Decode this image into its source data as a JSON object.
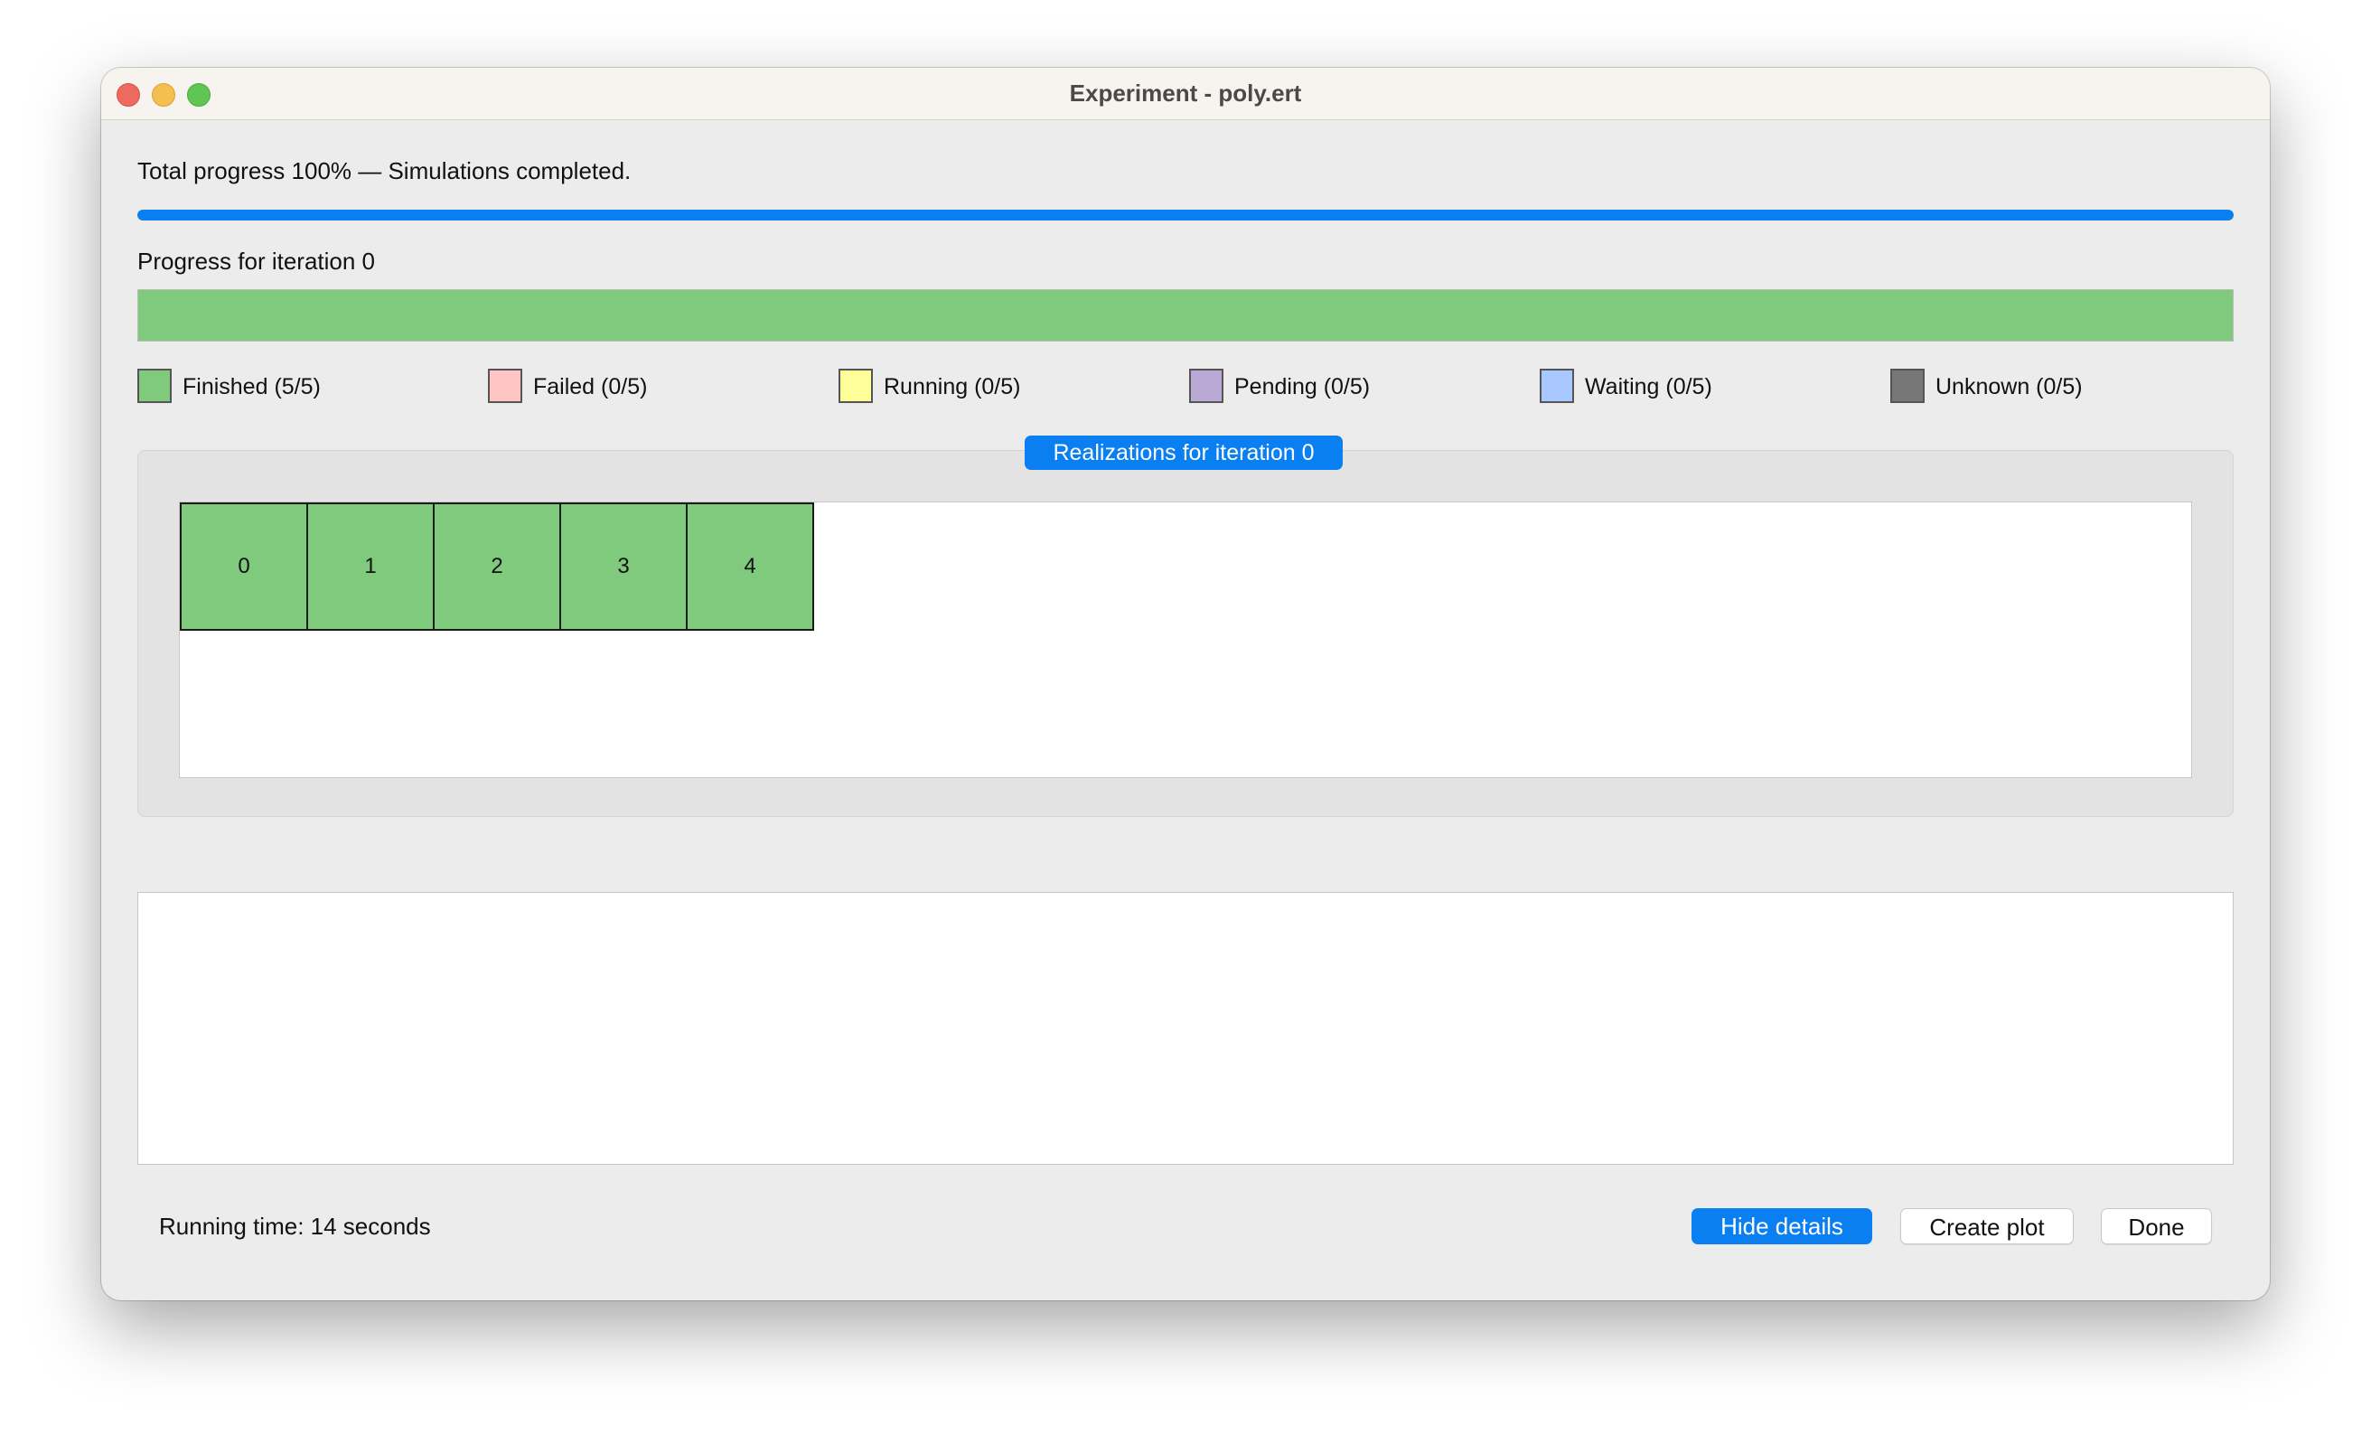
{
  "window": {
    "title": "Experiment - poly.ert"
  },
  "total_progress": {
    "label": "Total progress 100% — Simulations completed.",
    "value": 100
  },
  "iteration_progress": {
    "label": "Progress for iteration 0",
    "value": 100
  },
  "legend": [
    {
      "label": "Finished (5/5)",
      "color": "#7fca7c"
    },
    {
      "label": "Failed (0/5)",
      "color": "#ffc4c4"
    },
    {
      "label": "Running (0/5)",
      "color": "#ffff99"
    },
    {
      "label": "Pending (0/5)",
      "color": "#b9a9d4"
    },
    {
      "label": "Waiting (0/5)",
      "color": "#a8c8ff"
    },
    {
      "label": "Unknown (0/5)",
      "color": "#777777"
    }
  ],
  "realizations": {
    "title": "Realizations for iteration 0",
    "items": [
      {
        "id": "0",
        "status": "Finished"
      },
      {
        "id": "1",
        "status": "Finished"
      },
      {
        "id": "2",
        "status": "Finished"
      },
      {
        "id": "3",
        "status": "Finished"
      },
      {
        "id": "4",
        "status": "Finished"
      }
    ]
  },
  "footer": {
    "running_time": "Running time: 14 seconds",
    "hide_details_label": "Hide details",
    "create_plot_label": "Create plot",
    "done_label": "Done"
  },
  "colors": {
    "accent": "#0a7ff2",
    "finished": "#7fca7c"
  }
}
